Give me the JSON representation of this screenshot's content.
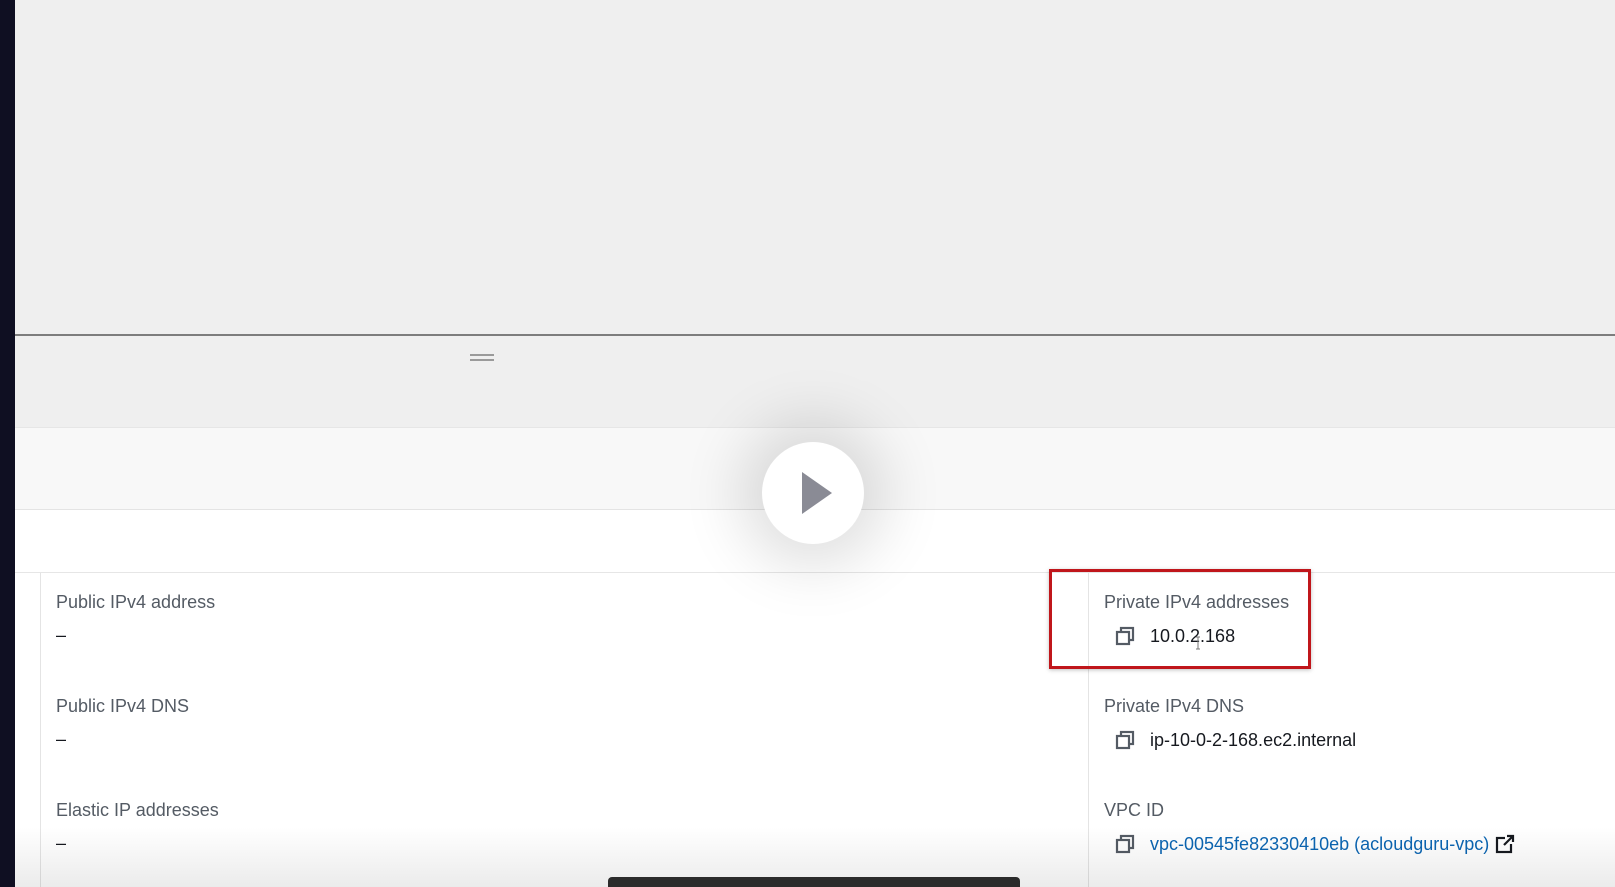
{
  "details": {
    "left_column": [
      {
        "label": "Public IPv4 address",
        "value": "–"
      },
      {
        "label": "Public IPv4 DNS",
        "value": "–"
      },
      {
        "label": "Elastic IP addresses",
        "value": "–"
      }
    ],
    "right_column": {
      "private_ipv4_addresses": {
        "label": "Private IPv4 addresses",
        "value": "10.0.2.168"
      },
      "private_ipv4_dns": {
        "label": "Private IPv4 DNS",
        "value": "ip-10-0-2-168.ec2.internal"
      },
      "vpc_id": {
        "label": "VPC ID",
        "value": "vpc-00545fe82330410eb (acloudguru-vpc)"
      }
    }
  },
  "colors": {
    "highlight_border": "#c0161b",
    "link": "#0b65b2",
    "label": "#545b64"
  },
  "icons": {
    "copy": "copy-icon",
    "external_link": "external-link-icon",
    "play": "play-icon",
    "drag_handle": "drag-handle-icon"
  }
}
